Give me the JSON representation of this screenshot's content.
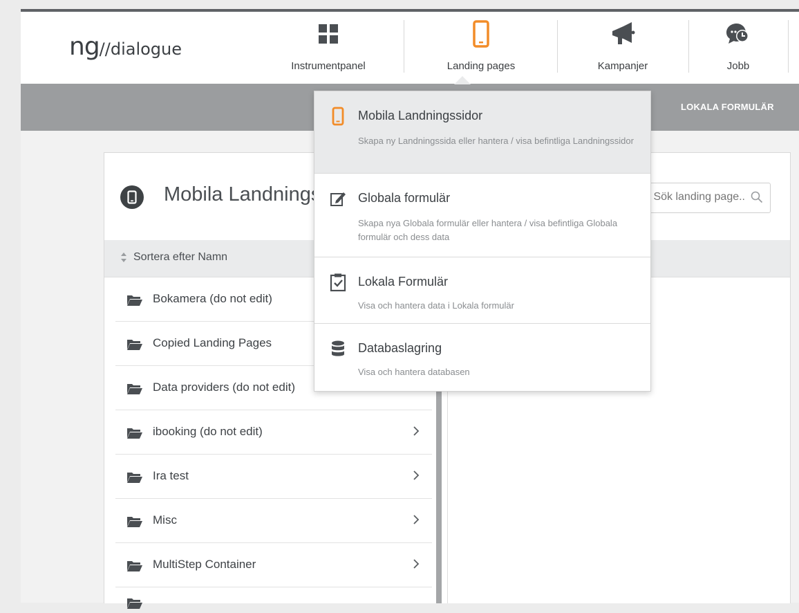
{
  "app": {
    "logo_ng": "ng",
    "logo_rest": "//dialogue"
  },
  "nav": [
    {
      "label": "Instrumentpanel",
      "icon": "dashboard-grid-icon"
    },
    {
      "label": "Landing pages",
      "icon": "mobile-phone-icon",
      "active": true
    },
    {
      "label": "Kampanjer",
      "icon": "megaphone-icon"
    },
    {
      "label": "Jobb",
      "icon": "chat-clock-icon"
    }
  ],
  "toolbar": {
    "link_label": "LOKALA FORMULÄR"
  },
  "panel": {
    "title": "Mobila Landningssidor",
    "search_placeholder": "Sök landing page..",
    "sort_label": "Sortera efter Namn"
  },
  "folders": [
    {
      "name": "Bokamera (do not edit)"
    },
    {
      "name": "Copied Landing Pages"
    },
    {
      "name": "Data providers (do not edit)"
    },
    {
      "name": "ibooking (do not edit)"
    },
    {
      "name": "Ira test"
    },
    {
      "name": "Misc"
    },
    {
      "name": "MultiStep Container"
    },
    {
      "name": ""
    }
  ],
  "dropdown": {
    "items": [
      {
        "title": "Mobila Landningssidor",
        "description": "Skapa ny Landningssida eller hantera / visa befintliga Landningssidor",
        "icon": "mobile-phone-icon"
      },
      {
        "title": "Globala formulär",
        "description": "Skapa nya Globala formulär eller hantera / visa befintliga Globala formulär och dess data",
        "icon": "edit-form-icon"
      },
      {
        "title": "Lokala Formulär",
        "description": "Visa och hantera data i Lokala formulär",
        "icon": "clipboard-check-icon"
      },
      {
        "title": "Databaslagring",
        "description": "Visa och hantera databasen",
        "icon": "database-icon"
      }
    ]
  },
  "colors": {
    "accent_orange": "#f28c28",
    "toolbar_gray": "#9b9d9f",
    "dark_icon": "#3e4245"
  }
}
